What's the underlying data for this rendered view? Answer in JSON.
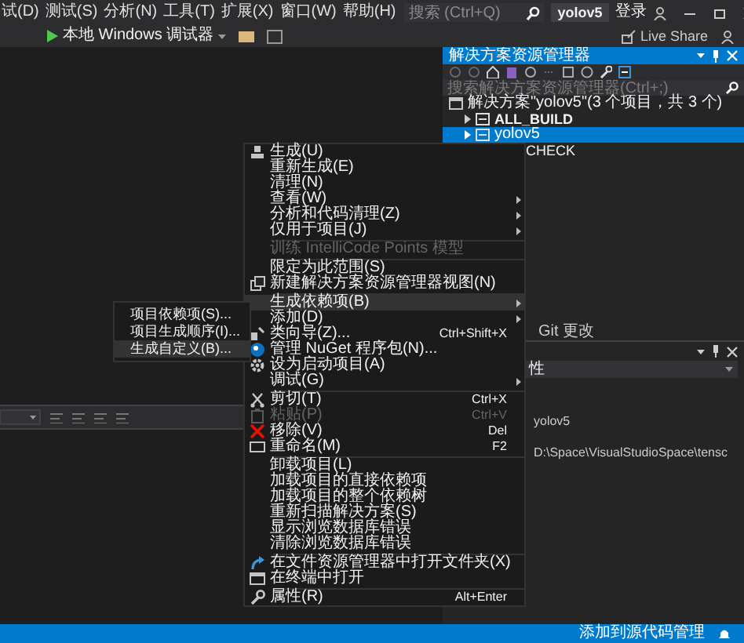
{
  "menubar": [
    {
      "label": "试(D)"
    },
    {
      "label": "测试(S)"
    },
    {
      "label": "分析(N)"
    },
    {
      "label": "工具(T)"
    },
    {
      "label": "扩展(X)"
    },
    {
      "label": "窗口(W)"
    },
    {
      "label": "帮助(H)"
    }
  ],
  "search": {
    "placeholder": "搜索 (Ctrl+Q)"
  },
  "project_name": "yolov5",
  "sign_in": "登录",
  "toolbar": {
    "debugger": "本地 Windows 调试器",
    "live_share": "Live Share"
  },
  "solution_explorer": {
    "title": "解决方案资源管理器",
    "search": {
      "placeholder": "搜索解决方案资源管理器(Ctrl+;)"
    },
    "tree": [
      {
        "label": "解决方案\"yolov5\"(3 个项目，共 3 个)",
        "selected": false,
        "children": [
          {
            "label": "ALL_BUILD",
            "selected": false,
            "bold": true
          },
          {
            "label": "yolov5",
            "selected": true,
            "bold": false
          },
          {
            "label": "CHECK",
            "selected": false,
            "bold": false
          }
        ]
      }
    ]
  },
  "bottom_tabs": [
    {
      "label": "Git 更改",
      "selected": false
    }
  ],
  "properties": {
    "header": "性",
    "rows": [
      {
        "value": "yolov5"
      },
      {
        "value": "D:\\Space\\VisualStudioSpace\\tensc"
      }
    ]
  },
  "context_menu": [
    {
      "kind": "item",
      "label": "生成(U)",
      "has_submenu": false,
      "disabled": false,
      "selected": false
    },
    {
      "kind": "item",
      "label": "重新生成(E)",
      "has_submenu": false,
      "disabled": false,
      "selected": false
    },
    {
      "kind": "item",
      "label": "清理(N)",
      "has_submenu": false,
      "disabled": false,
      "selected": false
    },
    {
      "kind": "item",
      "label": "查看(W)",
      "has_submenu": true,
      "disabled": false,
      "selected": false
    },
    {
      "kind": "item",
      "label": "分析和代码清理(Z)",
      "has_submenu": true,
      "disabled": false,
      "selected": false
    },
    {
      "kind": "item",
      "label": "仅用于项目(J)",
      "has_submenu": true,
      "disabled": false,
      "selected": false
    },
    {
      "kind": "separator"
    },
    {
      "kind": "item",
      "label": "训练 IntelliCode Points 模型",
      "has_submenu": false,
      "disabled": true,
      "selected": false
    },
    {
      "kind": "separator"
    },
    {
      "kind": "item",
      "label": "限定为此范围(S)",
      "has_submenu": false,
      "disabled": false,
      "selected": false
    },
    {
      "kind": "item",
      "label": "新建解决方案资源管理器视图(N)",
      "has_submenu": false,
      "disabled": false,
      "selected": false
    },
    {
      "kind": "separator"
    },
    {
      "kind": "item",
      "label": "生成依赖项(B)",
      "has_submenu": true,
      "disabled": false,
      "selected": true
    },
    {
      "kind": "item",
      "label": "添加(D)",
      "has_submenu": true,
      "disabled": false,
      "selected": false
    },
    {
      "kind": "item",
      "label": "类向导(Z)...",
      "shortcut": "Ctrl+Shift+X",
      "has_submenu": false,
      "disabled": false,
      "selected": false
    },
    {
      "kind": "item",
      "label": "管理 NuGet 程序包(N)...",
      "has_submenu": false,
      "disabled": false,
      "selected": false
    },
    {
      "kind": "item",
      "label": "设为启动项目(A)",
      "has_submenu": false,
      "disabled": false,
      "selected": false
    },
    {
      "kind": "item",
      "label": "调试(G)",
      "has_submenu": true,
      "disabled": false,
      "selected": false
    },
    {
      "kind": "separator"
    },
    {
      "kind": "item",
      "label": "剪切(T)",
      "shortcut": "Ctrl+X",
      "has_submenu": false,
      "disabled": false,
      "selected": false
    },
    {
      "kind": "item",
      "label": "粘贴(P)",
      "shortcut": "Ctrl+V",
      "has_submenu": false,
      "disabled": true,
      "selected": false
    },
    {
      "kind": "item",
      "label": "移除(V)",
      "shortcut": "Del",
      "has_submenu": false,
      "disabled": false,
      "selected": false
    },
    {
      "kind": "item",
      "label": "重命名(M)",
      "shortcut": "F2",
      "has_submenu": false,
      "disabled": false,
      "selected": false
    },
    {
      "kind": "separator"
    },
    {
      "kind": "item",
      "label": "卸载项目(L)",
      "has_submenu": false,
      "disabled": false,
      "selected": false
    },
    {
      "kind": "item",
      "label": "加载项目的直接依赖项",
      "has_submenu": false,
      "disabled": false,
      "selected": false
    },
    {
      "kind": "item",
      "label": "加载项目的整个依赖树",
      "has_submenu": false,
      "disabled": false,
      "selected": false
    },
    {
      "kind": "item",
      "label": "重新扫描解决方案(S)",
      "has_submenu": false,
      "disabled": false,
      "selected": false
    },
    {
      "kind": "item",
      "label": "显示浏览数据库错误",
      "has_submenu": false,
      "disabled": false,
      "selected": false
    },
    {
      "kind": "item",
      "label": "清除浏览数据库错误",
      "has_submenu": false,
      "disabled": false,
      "selected": false
    },
    {
      "kind": "separator"
    },
    {
      "kind": "item",
      "label": "在文件资源管理器中打开文件夹(X)",
      "has_submenu": false,
      "disabled": false,
      "selected": false
    },
    {
      "kind": "item",
      "label": "在终端中打开",
      "has_submenu": false,
      "disabled": false,
      "selected": false
    },
    {
      "kind": "separator"
    },
    {
      "kind": "item",
      "label": "属性(R)",
      "shortcut": "Alt+Enter",
      "has_submenu": false,
      "disabled": false,
      "selected": false
    }
  ],
  "submenu": [
    {
      "label": "项目依赖项(S)...",
      "selected": false
    },
    {
      "label": "项目生成顺序(I)...",
      "selected": false
    },
    {
      "label": "生成自定义(B)...",
      "selected": true
    }
  ],
  "status_bar": {
    "source_control": "添加到源代码管理"
  }
}
